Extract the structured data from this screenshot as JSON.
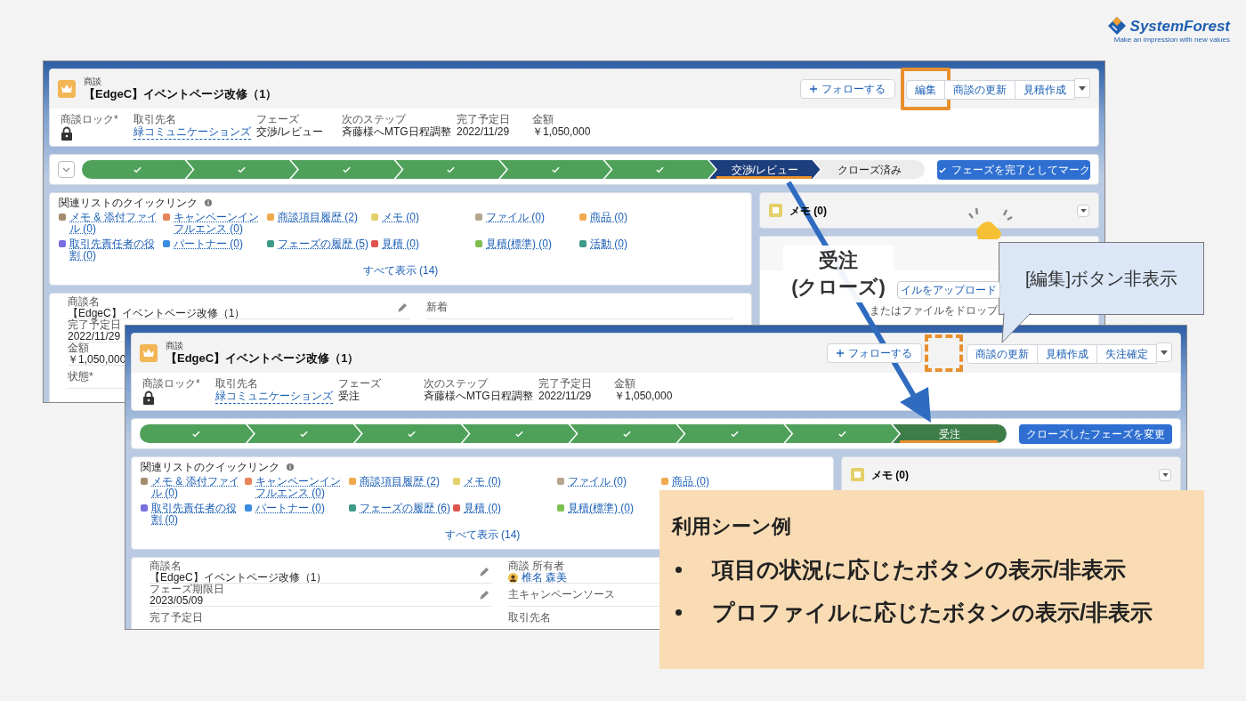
{
  "logo": {
    "name": "SystemForest",
    "tagline": "Make an impression with new values"
  },
  "screens": [
    {
      "object": "商談",
      "title": "【EdgeC】イベントページ改修（1）",
      "follow": "フォローする",
      "hidden_marker": false,
      "actions": [
        {
          "label": "編集",
          "highlighted": true
        },
        {
          "label": "商談の更新",
          "highlighted": false
        },
        {
          "label": "見積作成",
          "highlighted": false
        }
      ],
      "fields": [
        {
          "label": "商談ロック*",
          "kind": "lock"
        },
        {
          "label": "取引先名",
          "value": "緑コミュニケーションズ",
          "kind": "link"
        },
        {
          "label": "フェーズ",
          "value": "交渉/レビュー",
          "kind": "text"
        },
        {
          "label": "次のステップ",
          "value": "斉藤様へMTG日程調整",
          "kind": "text"
        },
        {
          "label": "完了予定日",
          "value": "2022/11/29",
          "kind": "text"
        },
        {
          "label": "金額",
          "value": "￥1,050,000",
          "kind": "text"
        }
      ],
      "path": {
        "toggle": true,
        "button": "フェーズを完了としてマーク",
        "button_check": true,
        "steps": [
          {
            "kind": "done"
          },
          {
            "kind": "done"
          },
          {
            "kind": "done"
          },
          {
            "kind": "done"
          },
          {
            "kind": "done"
          },
          {
            "kind": "done"
          },
          {
            "kind": "current",
            "label": "交渉/レビュー"
          },
          {
            "kind": "todo",
            "label": "クローズ済み"
          }
        ]
      },
      "quick_links": {
        "title": "関連リストのクイックリンク",
        "show_all": "すべて表示 (14)",
        "links": [
          {
            "label": "メモ & 添付ファイル (0)",
            "color": "#a48d6e"
          },
          {
            "label": "キャンペーンインフルエンス (0)",
            "color": "#e8845a"
          },
          {
            "label": "商談項目履歴 (2)",
            "color": "#f0a94f"
          },
          {
            "label": "メモ (0)",
            "color": "#e4d06a"
          },
          {
            "label": "ファイル (0)",
            "color": "#b5a48e"
          },
          {
            "label": "商品 (0)",
            "color": "#f0a94f"
          },
          {
            "label": "取引先責任者の役割 (0)",
            "color": "#7a6fe0"
          },
          {
            "label": "パートナー (0)",
            "color": "#3a8de0"
          },
          {
            "label": "フェーズの履歴 (5)",
            "color": "#3f9a8a"
          },
          {
            "label": "見積 (0)",
            "color": "#e0554f"
          },
          {
            "label": "見積(標準) (0)",
            "color": "#7fbf4f"
          },
          {
            "label": "活動 (0)",
            "color": "#3f9a8a"
          }
        ]
      },
      "side_cards": [
        {
          "kind": "memo",
          "title": "メモ (0)"
        },
        {
          "kind": "files",
          "upload": "イルをアップロード",
          "drop": "またはファイルをドロップ"
        }
      ],
      "details": {
        "left": [
          {
            "label": "商談名",
            "value": "【EdgeC】イベントページ改修（1）",
            "kind": "text",
            "editable": true
          },
          {
            "label": "完了予定日",
            "value": "2022/11/29",
            "kind": "text"
          },
          {
            "label": "金額",
            "value": "￥1,050,000",
            "kind": "text"
          },
          {
            "label": "状態*"
          }
        ],
        "right": [
          {
            "label": "新着"
          }
        ]
      }
    },
    {
      "object": "商談",
      "title": "【EdgeC】イベントページ改修（1）",
      "follow": "フォローする",
      "hidden_marker": true,
      "actions": [
        {
          "label": "商談の更新",
          "highlighted": false
        },
        {
          "label": "見積作成",
          "highlighted": false
        },
        {
          "label": "失注確定",
          "highlighted": false
        }
      ],
      "fields": [
        {
          "label": "商談ロック*",
          "kind": "lock"
        },
        {
          "label": "取引先名",
          "value": "緑コミュニケーションズ",
          "kind": "link"
        },
        {
          "label": "フェーズ",
          "value": "受注",
          "kind": "text"
        },
        {
          "label": "次のステップ",
          "value": "斉藤様へMTG日程調整",
          "kind": "text"
        },
        {
          "label": "完了予定日",
          "value": "2022/11/29",
          "kind": "text"
        },
        {
          "label": "金額",
          "value": "￥1,050,000",
          "kind": "text"
        }
      ],
      "path": {
        "toggle": false,
        "button": "クローズしたフェーズを変更",
        "button_check": false,
        "steps": [
          {
            "kind": "done"
          },
          {
            "kind": "done"
          },
          {
            "kind": "done"
          },
          {
            "kind": "done"
          },
          {
            "kind": "done"
          },
          {
            "kind": "done"
          },
          {
            "kind": "done"
          },
          {
            "kind": "won",
            "label": "受注"
          }
        ]
      },
      "quick_links": {
        "title": "関連リストのクイックリンク",
        "show_all": "すべて表示 (14)",
        "links": [
          {
            "label": "メモ & 添付ファイル (0)",
            "color": "#a48d6e"
          },
          {
            "label": "キャンペーンインフルエンス (0)",
            "color": "#e8845a"
          },
          {
            "label": "商談項目履歴 (2)",
            "color": "#f0a94f"
          },
          {
            "label": "メモ (0)",
            "color": "#e4d06a"
          },
          {
            "label": "ファイル (0)",
            "color": "#b5a48e"
          },
          {
            "label": "商品 (0)",
            "color": "#f0a94f"
          },
          {
            "label": "取引先責任者の役割 (0)",
            "color": "#7a6fe0"
          },
          {
            "label": "パートナー (0)",
            "color": "#3a8de0"
          },
          {
            "label": "フェーズの履歴 (6)",
            "color": "#3f9a8a"
          },
          {
            "label": "見積 (0)",
            "color": "#e0554f"
          },
          {
            "label": "見積(標準) (0)",
            "color": "#7fbf4f"
          }
        ]
      },
      "side_cards": [
        {
          "kind": "memo",
          "title": "メモ (0)"
        }
      ],
      "details": {
        "left": [
          {
            "label": "商談名",
            "value": "【EdgeC】イベントページ改修（1）",
            "kind": "text",
            "editable": true
          },
          {
            "label": "フェーズ期限日",
            "value": "2023/05/09",
            "kind": "text",
            "editable": true
          },
          {
            "label": "完了予定日"
          }
        ],
        "right": [
          {
            "label": "商談 所有者",
            "value": "椎名 森美",
            "kind": "user"
          },
          {
            "label": "主キャンペーンソース"
          },
          {
            "label": "取引先名"
          }
        ]
      }
    }
  ],
  "arrow_label": [
    "受注",
    "(クローズ)"
  ],
  "callout": "[編集]ボタン非表示",
  "usage": {
    "title": "利用シーン例",
    "bullets": [
      "項目の状況に応じたボタンの表示/非表示",
      "プロファイルに応じたボタンの表示/非表示"
    ]
  }
}
